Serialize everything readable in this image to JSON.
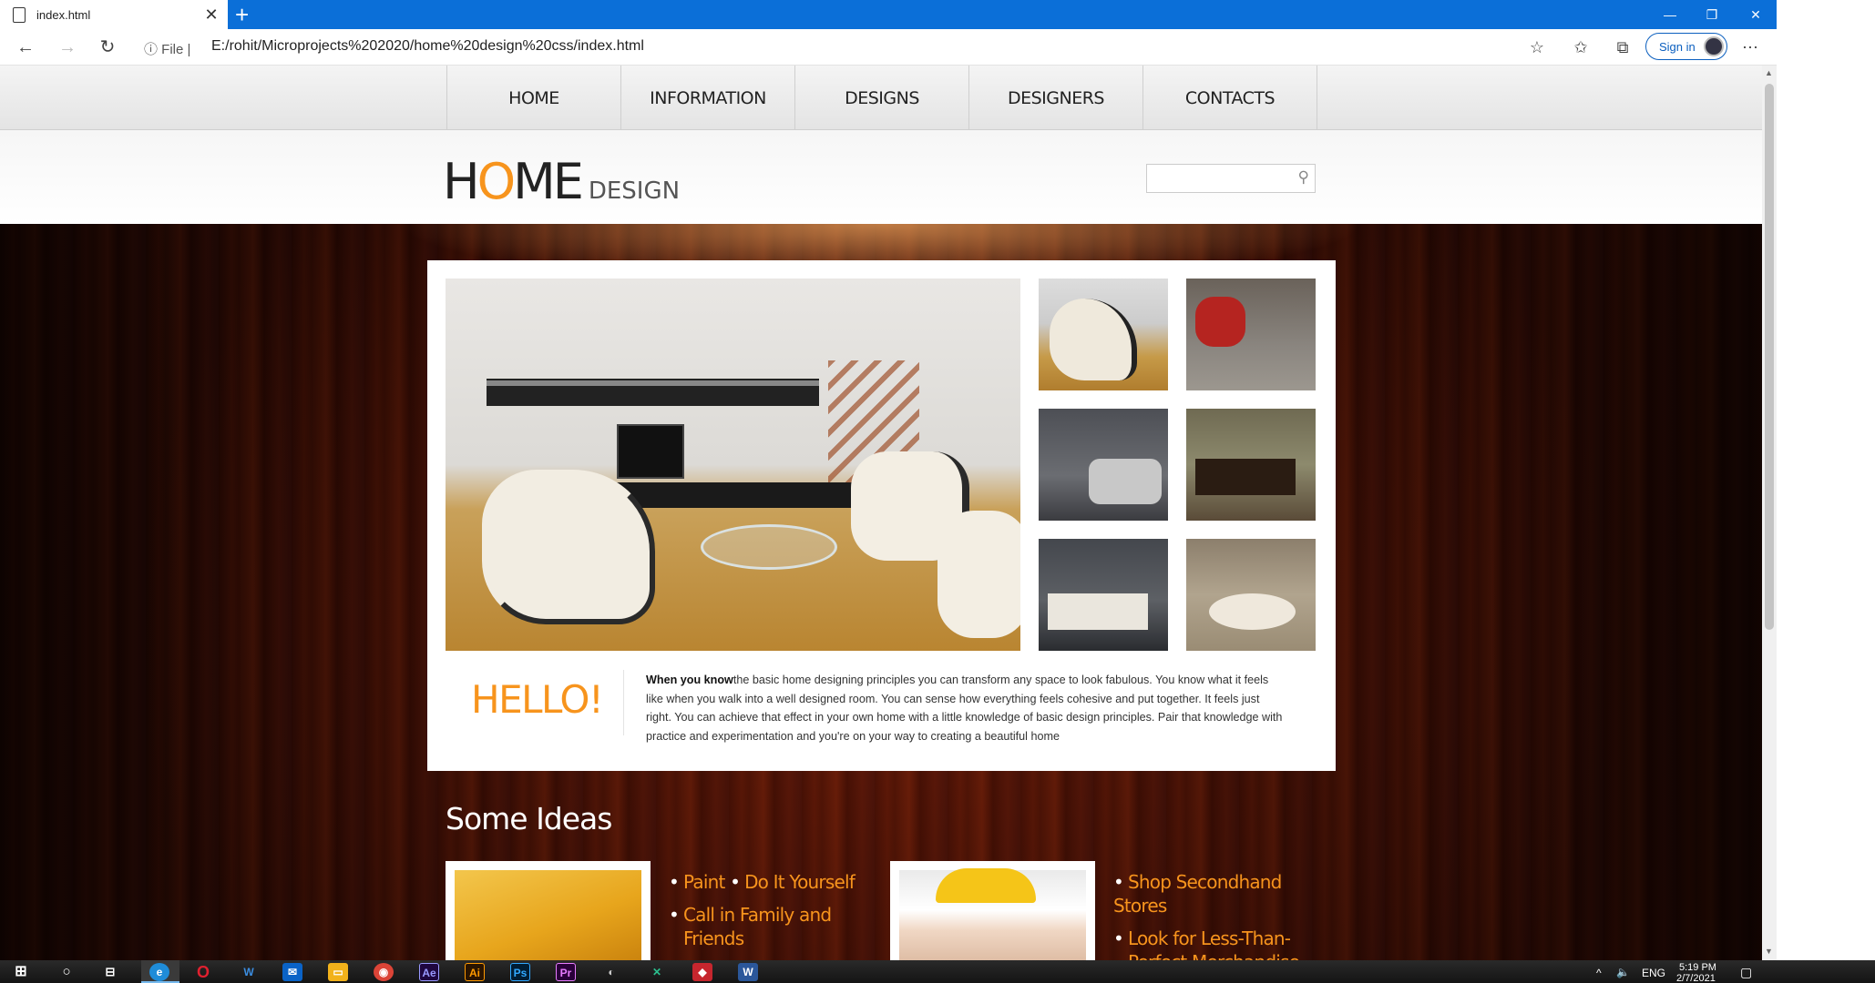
{
  "browser": {
    "tab_title": "index.html",
    "new_tab": "+",
    "url_label": "File",
    "url": "E:/rohit/Microprojects%202020/home%20design%20css/index.html",
    "sign_in": "Sign in"
  },
  "site": {
    "nav": [
      "HOME",
      "INFORMATION",
      "DESIGNS",
      "DESIGNERS",
      "CONTACTS"
    ],
    "logo_home_h": "H",
    "logo_home_o": "O",
    "logo_home_me": "M",
    "logo_home_e": "E",
    "logo_design": "DESIGN",
    "search_placeholder": "",
    "hello": "HELLO!",
    "intro_bold": "When you know",
    "intro_text": "the basic home designing principles you can transform any space to look fabulous. You know what it feels like when you walk into a well designed room. You can sense how everything feels cohesive and put together. It feels just right. You can achieve that effect in your own home with a little knowledge of basic design principles. Pair that knowledge with practice and experimentation and you're on your way to creating a beautiful home",
    "ideas_title": "Some Ideas",
    "ideas_left": {
      "item1a": "Paint",
      "item1b": "Do It Yourself",
      "item2": "Call in Family and Friends"
    },
    "ideas_right": {
      "item1": "Shop Secondhand Stores",
      "item2": "Look for Less-Than-Perfect Merchandise"
    }
  },
  "taskbar": {
    "lang": "ENG",
    "time": "5:19 PM",
    "date": "2/7/2021"
  },
  "colors": {
    "accent_orange": "#f7941d",
    "browser_blue": "#0b6fd8"
  }
}
